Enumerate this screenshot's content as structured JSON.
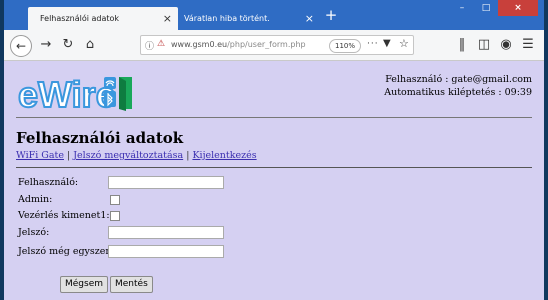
{
  "browser": {
    "tabs": [
      {
        "title": "Felhasználói adatok",
        "active": true
      },
      {
        "title": "Váratlan hiba történt.",
        "active": false
      }
    ],
    "tab_close_glyph": "×",
    "new_tab_glyph": "+",
    "window_controls": {
      "minimize": "–",
      "maximize": "□",
      "close": "×"
    },
    "url": {
      "domain": "www.gsm0.eu",
      "path": "/php/user_form.php"
    },
    "zoom": "110%",
    "page_actions_glyph": "···"
  },
  "header": {
    "logo_text": "eWire",
    "user_line": "Felhasználó : gate@gmail.com",
    "logout_line": "Automatikus kiléptetés : 09:39"
  },
  "page": {
    "title": "Felhasználói adatok",
    "nav": [
      {
        "label": "WiFi Gate"
      },
      {
        "label": "Jelszó megváltoztatása"
      },
      {
        "label": "Kijelentkezés"
      }
    ],
    "separator": "|"
  },
  "form": {
    "labels": {
      "user": "Felhasználó:",
      "admin": "Admin:",
      "output1": "Vezérlés kimenet1:",
      "password": "Jelszó:",
      "password2": "Jelszó még egyszer:"
    },
    "values": {
      "user": "",
      "password": "",
      "password2": ""
    },
    "admin_checked": false,
    "output1_checked": false,
    "cancel_label": "Mégsem",
    "save_label": "Mentés"
  },
  "colors": {
    "page_bg": "#d5d0f2",
    "link": "#3b2fb0",
    "tab_strip": "#2f6cc4",
    "logo_blue": "#3a97de",
    "logo_green": "#19a85a"
  }
}
